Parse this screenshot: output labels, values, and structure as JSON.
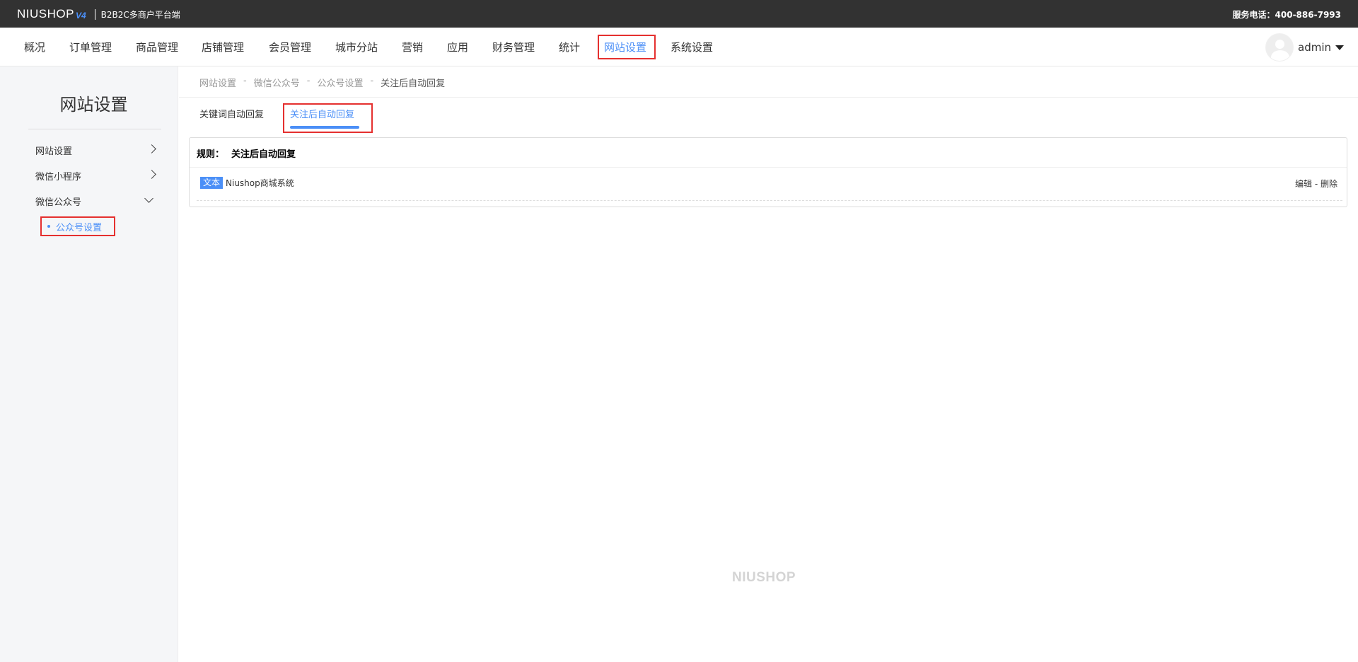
{
  "topbar": {
    "logo_text": "NIUSHOP",
    "logo_version": "V4",
    "subtitle": "B2B2C多商户平台端",
    "hotline": "服务电话：400-886-7993"
  },
  "nav": {
    "items": [
      {
        "label": "概况"
      },
      {
        "label": "订单管理"
      },
      {
        "label": "商品管理"
      },
      {
        "label": "店铺管理"
      },
      {
        "label": "会员管理"
      },
      {
        "label": "城市分站"
      },
      {
        "label": "营销"
      },
      {
        "label": "应用"
      },
      {
        "label": "财务管理"
      },
      {
        "label": "统计"
      },
      {
        "label": "网站设置"
      },
      {
        "label": "系统设置"
      }
    ],
    "active_index": 10,
    "user": "admin"
  },
  "sidebar": {
    "title": "网站设置",
    "items": [
      {
        "label": "网站设置",
        "state": "collapsed"
      },
      {
        "label": "微信小程序",
        "state": "collapsed"
      },
      {
        "label": "微信公众号",
        "state": "expanded"
      }
    ],
    "sub_items": [
      {
        "label": "公众号设置",
        "active": true
      }
    ]
  },
  "breadcrumb": [
    "网站设置",
    "微信公众号",
    "公众号设置",
    "关注后自动回复"
  ],
  "breadcrumb_sep": "-",
  "tabs": [
    {
      "label": "关键词自动回复"
    },
    {
      "label": "关注后自动回复",
      "active": true
    }
  ],
  "rule": {
    "label": "规则：",
    "value": "关注后自动回复",
    "reply": {
      "type_tag": "文本",
      "text": "Niushop商城系统",
      "edit": "编辑",
      "sep": "-",
      "delete": "删除"
    }
  },
  "footer_logo": "NIUSHOP",
  "colors": {
    "accent": "#4b8ff7",
    "highlight_box": "#e5302f",
    "topbar": "#323232",
    "sidebar_bg": "#f5f6f8"
  }
}
